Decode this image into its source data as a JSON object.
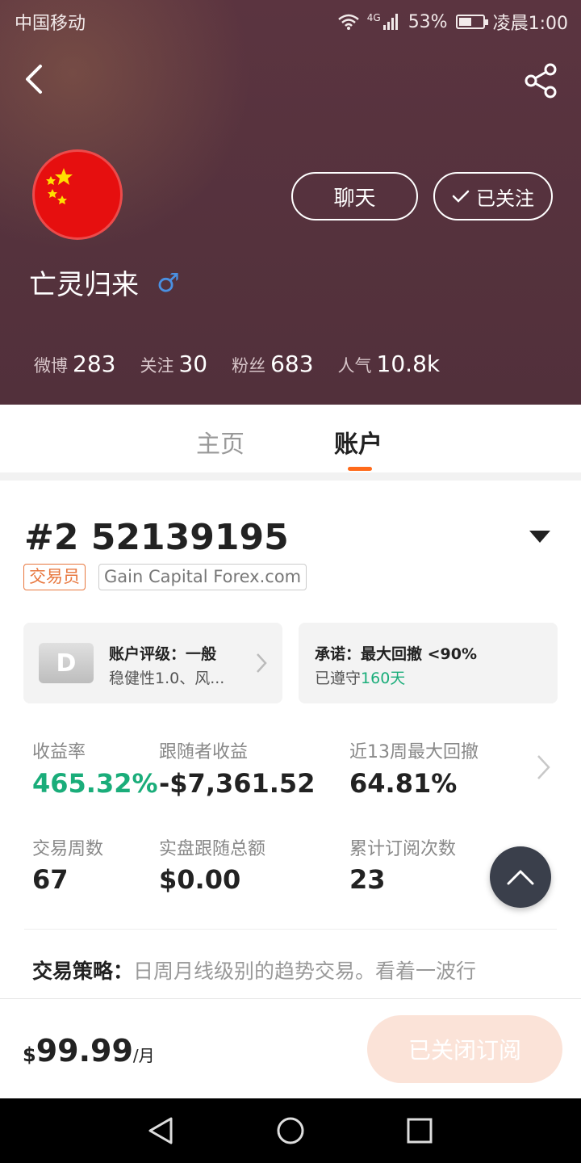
{
  "status_bar": {
    "carrier": "中国移动",
    "network": "4G",
    "battery_pct": "53%",
    "battery_level": 0.53,
    "time": "凌晨1:00"
  },
  "profile": {
    "name": "亡灵归来",
    "gender_symbol": "♂",
    "chat_label": "聊天",
    "follow_label": "已关注",
    "stats": [
      {
        "label": "微博",
        "value": "283"
      },
      {
        "label": "关注",
        "value": "30"
      },
      {
        "label": "粉丝",
        "value": "683"
      },
      {
        "label": "人气",
        "value": "10.8k"
      }
    ]
  },
  "tabs": [
    {
      "label": "主页",
      "active": false
    },
    {
      "label": "账户",
      "active": true
    }
  ],
  "account": {
    "title": "#2 52139195",
    "tag_role": "交易员",
    "tag_broker": "Gain Capital Forex.com",
    "rating_card": {
      "badge": "D",
      "line1": "账户评级：一般",
      "line2": "稳健性1.0、风..."
    },
    "promise_card": {
      "line1": "承诺：最大回撤 <90%",
      "line2_prefix": "已遵守",
      "line2_days": "160天"
    },
    "metrics": [
      {
        "label": "收益率",
        "value": "465.32%"
      },
      {
        "label": "跟随者收益",
        "value": "-$7,361.52"
      },
      {
        "label": "近13周最大回撤",
        "value": "64.81%"
      },
      {
        "label": "交易周数",
        "value": "67"
      },
      {
        "label": "实盘跟随总额",
        "value": "$0.00"
      },
      {
        "label": "累计订阅次数",
        "value": "23"
      }
    ],
    "strategy_label": "交易策略：",
    "strategy_text": "日周月线级别的趋势交易。看着一波行"
  },
  "subscription": {
    "currency": "$",
    "amount": "99.99",
    "unit": "/月",
    "button_label": "已关闭订阅"
  },
  "colors": {
    "accent_orange": "#ff6a1a",
    "green": "#1aad7a",
    "header_bg": "#55323d"
  },
  "icons": [
    "back-arrow-icon",
    "share-icon",
    "check-icon",
    "chevron-right-icon",
    "dropdown-triangle-icon",
    "arrow-up-icon",
    "nav-back-icon",
    "nav-home-icon",
    "nav-recents-icon"
  ]
}
